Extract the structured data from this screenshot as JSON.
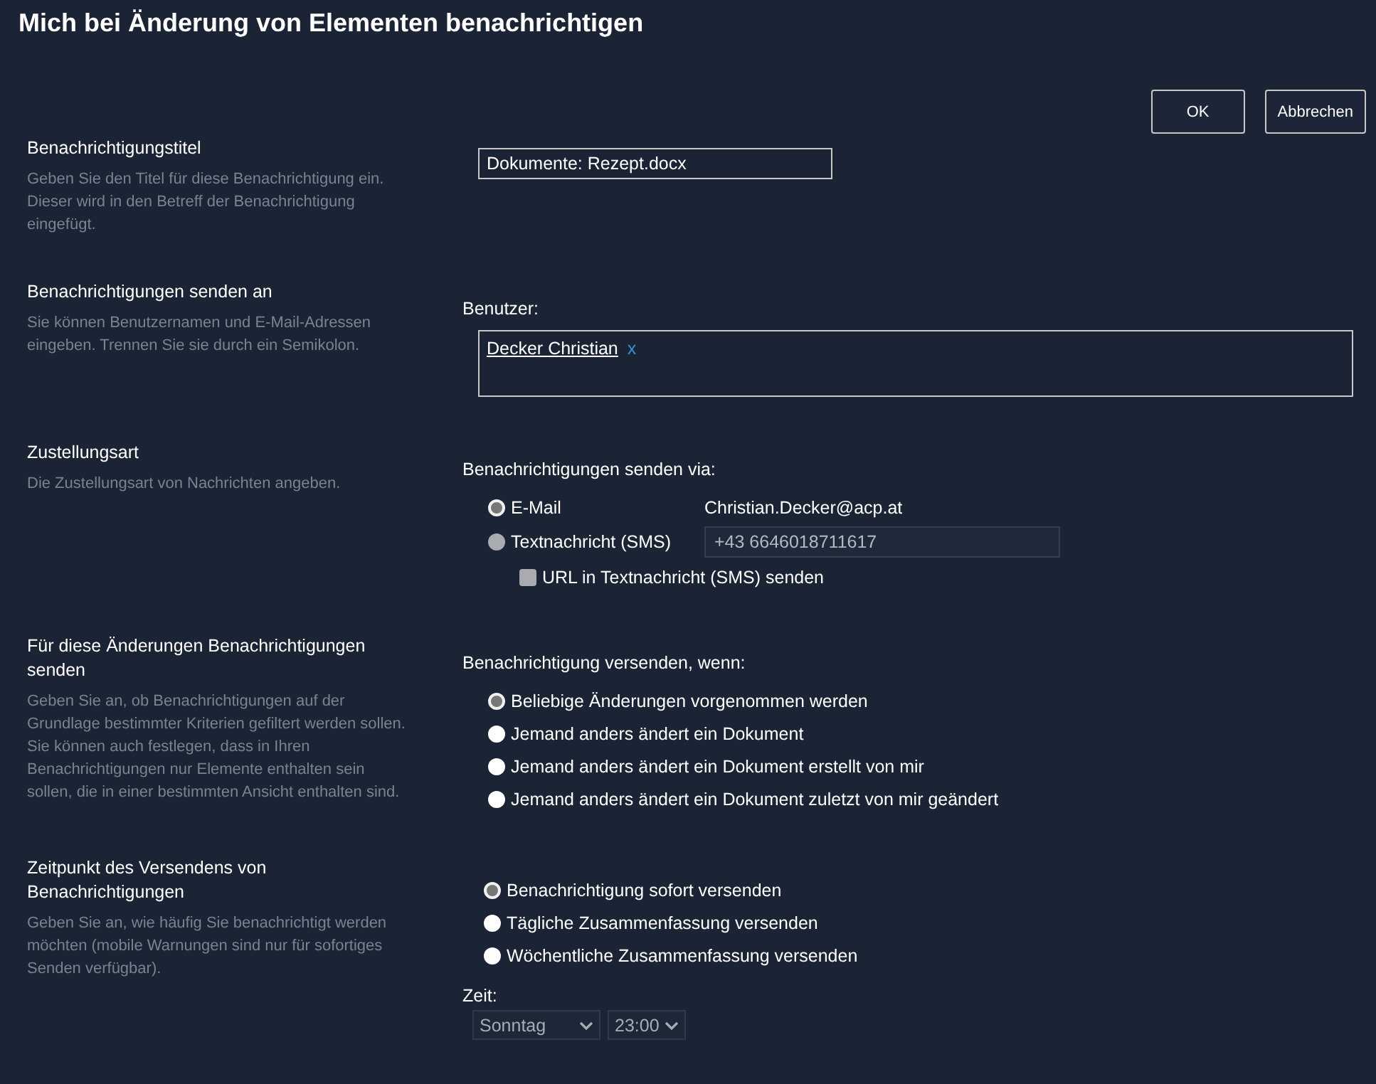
{
  "title": "Mich bei Änderung von Elementen benachrichtigen",
  "buttons": [
    {
      "label": "OK"
    },
    {
      "label": "Abbrechen"
    }
  ],
  "title_section": {
    "heading": "Benachrichtigungstitel",
    "description": "Geben Sie den Titel für diese Benachrichtigung ein. Dieser wird in den Betreff der Benachrichtigung eingefügt.",
    "value": "Dokumente: Rezept.docx"
  },
  "recipients_section": {
    "heading": "Benachrichtigungen senden an",
    "description": "Sie können Benutzernamen und E-Mail-Adressen eingeben. Trennen Sie sie durch ein Semikolon.",
    "field_label": "Benutzer:",
    "users": [
      {
        "name": "Decker Christian",
        "remove": "x"
      }
    ]
  },
  "delivery_section": {
    "heading": "Zustellungsart",
    "description": "Die Zustellungsart von Nachrichten angeben.",
    "prompt": "Benachrichtigungen senden via:",
    "options": [
      {
        "label": "E-Mail",
        "selected": true,
        "disabled": false,
        "kind": "text",
        "value": "Christian.Decker@acp.at"
      },
      {
        "label": "Textnachricht (SMS)",
        "selected": false,
        "disabled": true,
        "kind": "field",
        "value": "+43 6646018711617"
      }
    ],
    "checkbox": {
      "label": "URL in Textnachricht (SMS) senden",
      "checked": false,
      "disabled": true
    }
  },
  "changes_section": {
    "heading": "Für diese Änderungen Benachrichtigungen senden",
    "description": "Geben Sie an, ob Benachrichtigungen auf der Grundlage bestimmter Kriterien gefiltert werden sollen. Sie können auch festlegen, dass in Ihren Benachrichtigungen nur Elemente enthalten sein sollen, die in einer bestimmten Ansicht enthalten sind.",
    "prompt": "Benachrichtigung versenden, wenn:",
    "options": [
      {
        "label": "Beliebige Änderungen vorgenommen werden",
        "selected": true
      },
      {
        "label": "Jemand anders ändert ein Dokument",
        "selected": false
      },
      {
        "label": "Jemand anders ändert ein Dokument erstellt von mir",
        "selected": false
      },
      {
        "label": "Jemand anders ändert ein Dokument zuletzt von mir geändert",
        "selected": false
      }
    ]
  },
  "timing_section": {
    "heading": "Zeitpunkt des Versendens von Benachrichtigungen",
    "description": "Geben Sie an, wie häufig Sie benachrichtigt werden möchten (mobile Warnungen sind nur für sofortiges Senden verfügbar).",
    "options": [
      {
        "label": "Benachrichtigung sofort versenden",
        "selected": true
      },
      {
        "label": "Tägliche Zusammenfassung versenden",
        "selected": false
      },
      {
        "label": "Wöchentliche Zusammenfassung versenden",
        "selected": false
      }
    ],
    "time_label": "Zeit:",
    "day": {
      "value": "Sonntag",
      "disabled": true
    },
    "hour": {
      "value": "23:00",
      "disabled": true
    }
  }
}
